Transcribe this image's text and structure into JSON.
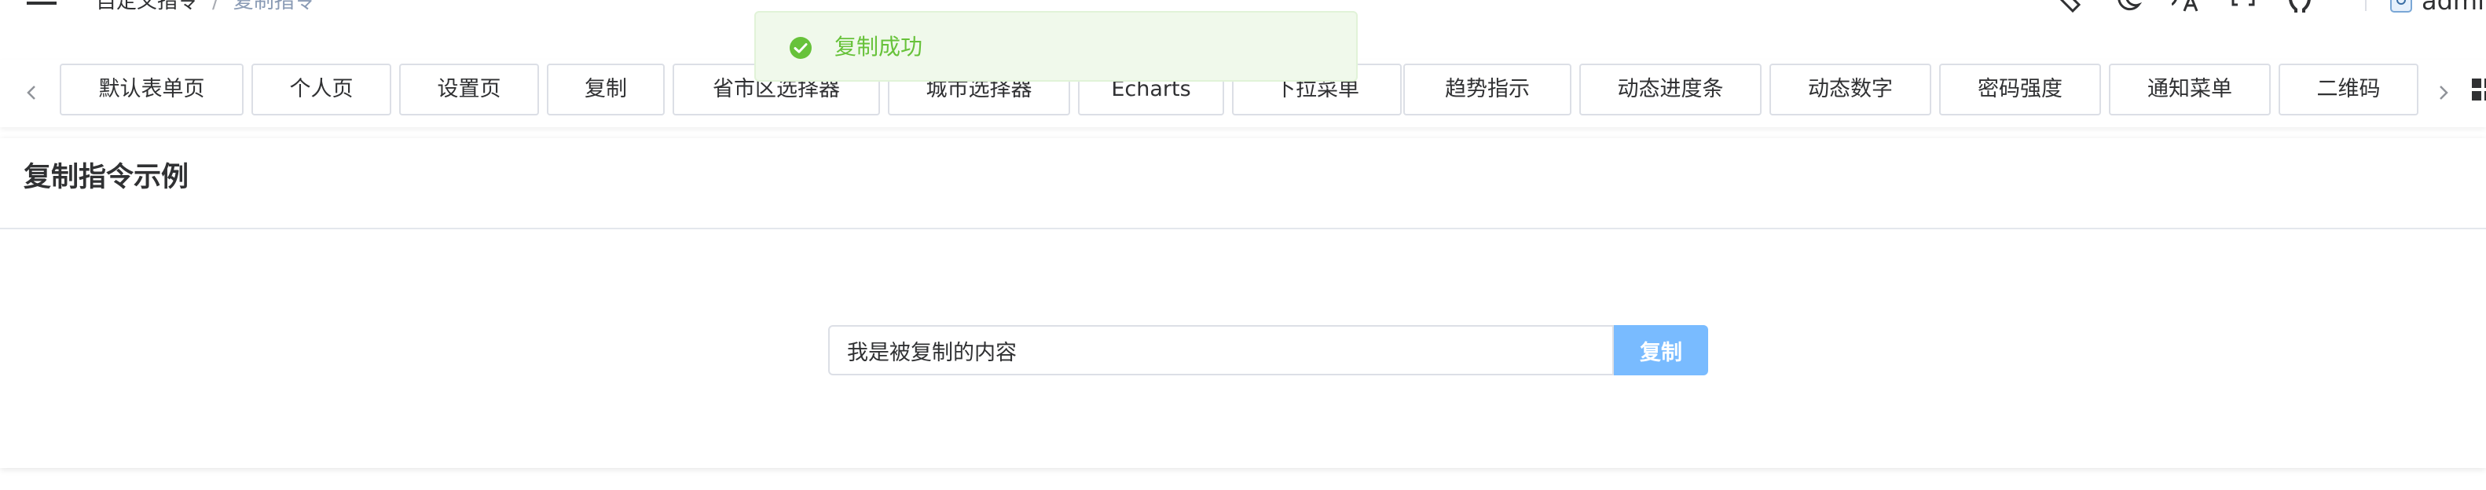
{
  "header": {
    "breadcrumb": {
      "parent": "自定义指令",
      "separator": "/",
      "current": "复制指令"
    },
    "user": {
      "name": "admin"
    },
    "tool_icons": [
      "ruler-icon",
      "moon-icon",
      "translate-icon",
      "fullscreen-icon",
      "github-icon"
    ]
  },
  "toast": {
    "type": "success",
    "text": "复制成功",
    "color": "#67c23a",
    "background": "#f0f9eb"
  },
  "tags": [
    "默认表单页",
    "个人页",
    "设置页",
    "复制",
    "省市区选择器",
    "城市选择器",
    "Echarts",
    "下拉菜单",
    "趋势指示",
    "动态进度条",
    "动态数字",
    "密码强度",
    "通知菜单",
    "二维码"
  ],
  "card": {
    "title": "复制指令示例",
    "input_value": "我是被复制的内容",
    "button_label": "复制",
    "button_color": "#79bbff"
  }
}
